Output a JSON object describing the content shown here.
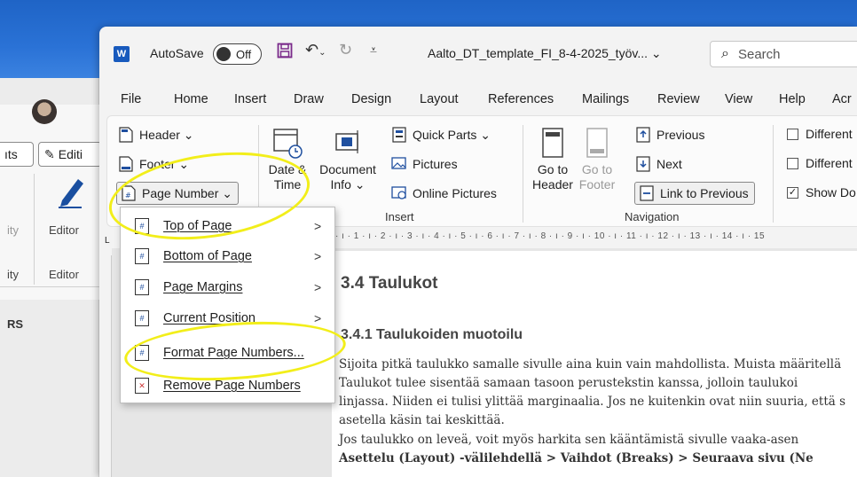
{
  "background": {
    "pills": [
      "ıts",
      "Editi"
    ],
    "side_labels": [
      "ity",
      "Editor",
      "ity",
      "Editor",
      "RS"
    ]
  },
  "titlebar": {
    "app_icon": "W",
    "autosave_label": "AutoSave",
    "autosave_state": "Off",
    "doc_title": "Aalto_DT_template_FI_8-4-2025_työv... ⌄",
    "search_placeholder": "Search"
  },
  "menu": [
    "File",
    "Home",
    "Insert",
    "Draw",
    "Design",
    "Layout",
    "References",
    "Mailings",
    "Review",
    "View",
    "Help",
    "Acr"
  ],
  "ribbon": {
    "header_footer": {
      "header": "Header ⌄",
      "footer": "Footer ⌄",
      "page_number": "Page Number ⌄"
    },
    "insert": {
      "date_time_1": "Date &",
      "date_time_2": "Time",
      "doc_info_1": "Document",
      "doc_info_2": "Info ⌄",
      "quick_parts": "Quick Parts ⌄",
      "pictures": "Pictures",
      "online_pictures": "Online Pictures",
      "group_label": "Insert"
    },
    "navigation": {
      "goto_header_1": "Go to",
      "goto_header_2": "Header",
      "goto_footer_1": "Go to",
      "goto_footer_2": "Footer",
      "previous": "Previous",
      "next": "Next",
      "link_to_previous": "Link to Previous",
      "group_label": "Navigation"
    },
    "options": {
      "different1": "Different",
      "different2": "Different",
      "show_doc": "Show Do"
    }
  },
  "ruler_text": "· ı · 1 · ı · 2 · ı · 3 · ı · 4 · ı · 5 · ı · 6 · ı · 7 · ı · 8 · ı · 9 · ı · 10 · ı · 11 · ı · 12 · ı · 13 · ı · 14 · ı · 15",
  "page_number_menu": [
    {
      "label": "Top of Page",
      "submenu": true,
      "icon": "page-top-icon"
    },
    {
      "label": "Bottom of Page",
      "submenu": true,
      "icon": "page-bottom-icon"
    },
    {
      "label": "Page Margins",
      "submenu": true,
      "icon": "page-margins-icon"
    },
    {
      "label": "Current Position",
      "submenu": true,
      "icon": "current-position-icon"
    },
    {
      "label": "Format Page Numbers...",
      "submenu": false,
      "icon": "format-page-numbers-icon"
    },
    {
      "label": "Remove Page Numbers",
      "submenu": false,
      "icon": "remove-page-numbers-icon"
    }
  ],
  "document": {
    "heading2": "3.4  Taulukot",
    "heading3": "3.4.1 Taulukoiden muotoilu",
    "paragraphs": [
      "Sijoita pitkä taulukko samalle sivulle aina kuin vain mahdollista. Muista määritellä",
      "    Taulukot tulee sisentää samaan tasoon perustekstin kanssa, jolloin taulukoi",
      "linjassa. Niiden ei tulisi ylittää marginaalia. Jos ne kuitenkin ovat niin suuria, että s",
      "asetella käsin tai keskittää.",
      "    Jos taulukko on leveä, voit myös harkita sen kääntämistä sivulle vaaka-asen",
      "Asettelu (Layout) -välilehdellä > Vaihdot (Breaks) > Seuraava sivu (Ne"
    ]
  },
  "colors": {
    "highlight": "#f2ee1a",
    "word_blue": "#185abd",
    "desktop_blue": "#2a72d6"
  }
}
